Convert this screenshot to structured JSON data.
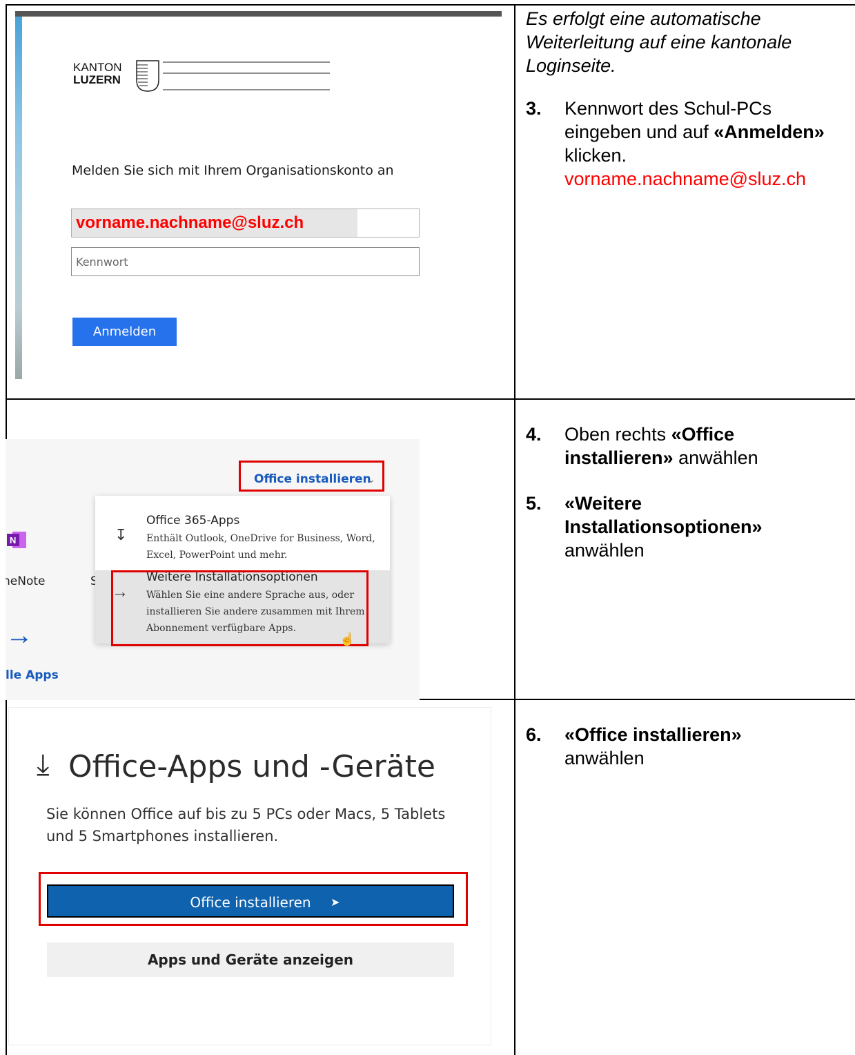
{
  "row1": {
    "note": "Es erfolgt eine automatische Weiterleitung auf eine kantonale Loginseite.",
    "step": {
      "number": "3.",
      "text_a": "Kennwort des Schul-PCs eingeben und auf ",
      "bold": "«Anmelden»",
      "text_b": " klicken.",
      "email": "vorname.nachname@sluz.ch"
    },
    "screenshot": {
      "logo_top": "KANTON",
      "logo_bottom": "LUZERN",
      "heading": "Melden Sie sich mit Ihrem Organisationskonto an",
      "email_value": "vorname.nachname@sluz.ch",
      "password_placeholder": "Kennwort",
      "button_label": "Anmelden"
    }
  },
  "row2": {
    "step4": {
      "number": "4.",
      "text_a": "Oben rechts ",
      "bold": "«Office installieren»",
      "text_b": " anwählen"
    },
    "step5": {
      "number": "5.",
      "bold": "«Weitere Installationsoptionen»",
      "text_b": " anwählen"
    },
    "screenshot": {
      "office_install_label": "Office installieren",
      "item1_title": "Office 365-Apps",
      "item1_desc": "Enthält Outlook, OneDrive for Business, Word, Excel, PowerPoint und mehr.",
      "item2_title": "Weitere Installationsoptionen",
      "item2_desc": "Wählen Sie eine andere Sprache aus, oder installieren Sie andere zusammen mit Ihrem Abonnement verfügbare Apps.",
      "onenote_label": "neNote",
      "s_label": "S",
      "alle_apps": "lle Apps"
    }
  },
  "row3": {
    "step6": {
      "number": "6.",
      "bold": "«Office installieren»",
      "text_b": " anwählen"
    },
    "screenshot": {
      "title": "Office-Apps und -Geräte",
      "desc": "Sie können Office auf bis zu 5 PCs oder Macs, 5 Tablets und 5 Smartphones installieren.",
      "install_button": "Office installieren",
      "apps_button": "Apps und Geräte anzeigen"
    }
  },
  "colors": {
    "accent_blue": "#2672ec",
    "install_blue": "#0f62ae",
    "highlight_red": "#ff0000"
  }
}
